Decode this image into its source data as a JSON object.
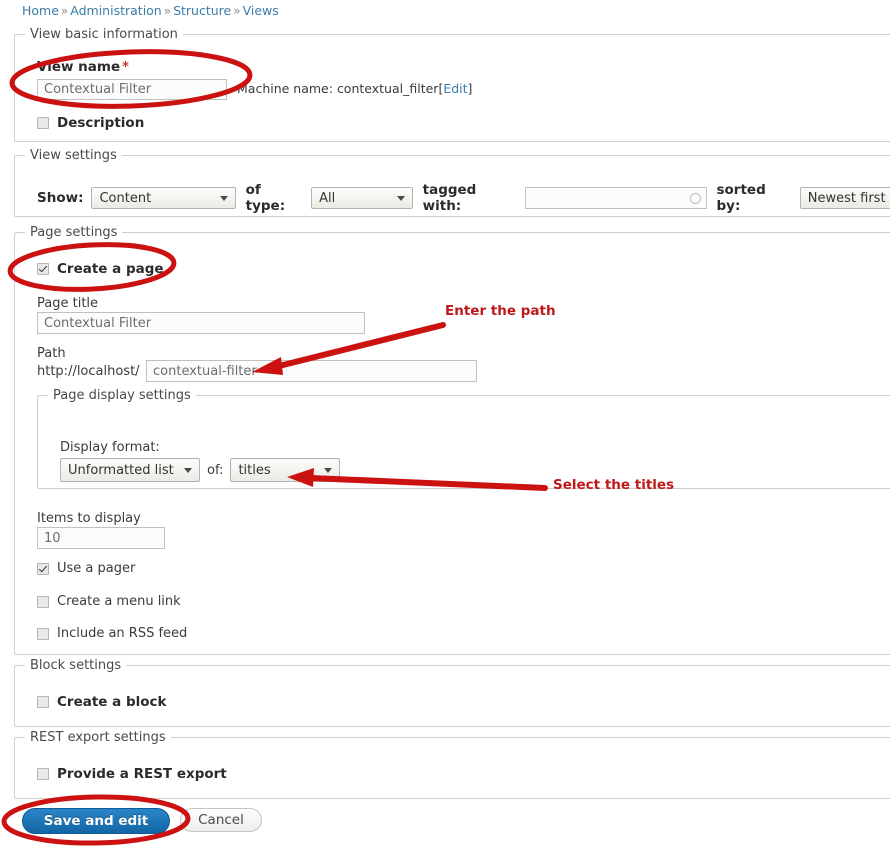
{
  "colors": {
    "annotation_red": "#c01818",
    "ellipse_red": "#cc1111",
    "link_blue": "#3b7ca8",
    "primary_button": "#1366a6",
    "required_star": "#c0392b"
  },
  "breadcrumb": {
    "separator": "»",
    "items": [
      "Home",
      "Administration",
      "Structure",
      "Views"
    ]
  },
  "basic_information": {
    "legend": "View basic information",
    "view_name_label": "View name",
    "required_marker": "*",
    "view_name_value": "Contextual Filter",
    "machine_name_prefix": "Machine name: ",
    "machine_name_value": "contextual_filter",
    "machine_name_edit_open": "[",
    "machine_name_edit": "Edit",
    "machine_name_edit_close": "]",
    "description_label": "Description",
    "description_checked": false
  },
  "view_settings": {
    "legend": "View settings",
    "show_label": "Show:",
    "show_value": "Content",
    "of_type_label": "of type:",
    "of_type_value": "All",
    "tagged_with_label": "tagged with:",
    "tagged_with_value": "",
    "tagged_with_placeholder": "",
    "sorted_by_label": "sorted by:",
    "sorted_by_value": "Newest first"
  },
  "page_settings": {
    "legend": "Page settings",
    "create_page_label": "Create a page",
    "create_page_checked": true,
    "page_title_label": "Page title",
    "page_title_value": "Contextual Filter",
    "path_label": "Path",
    "path_prefix": "http://localhost/",
    "path_value": "contextual-filter",
    "display_settings": {
      "legend": "Page display settings",
      "display_format_label": "Display format:",
      "display_format_value": "Unformatted list",
      "of_label": "of:",
      "of_value": "titles"
    },
    "items_to_display_label": "Items to display",
    "items_to_display_value": "10",
    "use_pager_label": "Use a pager",
    "use_pager_checked": true,
    "menu_link_label": "Create a menu link",
    "menu_link_checked": false,
    "rss_feed_label": "Include an RSS feed",
    "rss_feed_checked": false
  },
  "block_settings": {
    "legend": "Block settings",
    "create_block_label": "Create a block",
    "create_block_checked": false
  },
  "rest_export_settings": {
    "legend": "REST export settings",
    "provide_rest_label": "Provide a REST export",
    "provide_rest_checked": false
  },
  "actions": {
    "save_label": "Save and edit",
    "cancel_label": "Cancel"
  },
  "annotations": [
    {
      "text": "Enter the path",
      "name": "annotation-enter-the-path"
    },
    {
      "text": "Select the titles",
      "name": "annotation-select-the-titles"
    }
  ]
}
